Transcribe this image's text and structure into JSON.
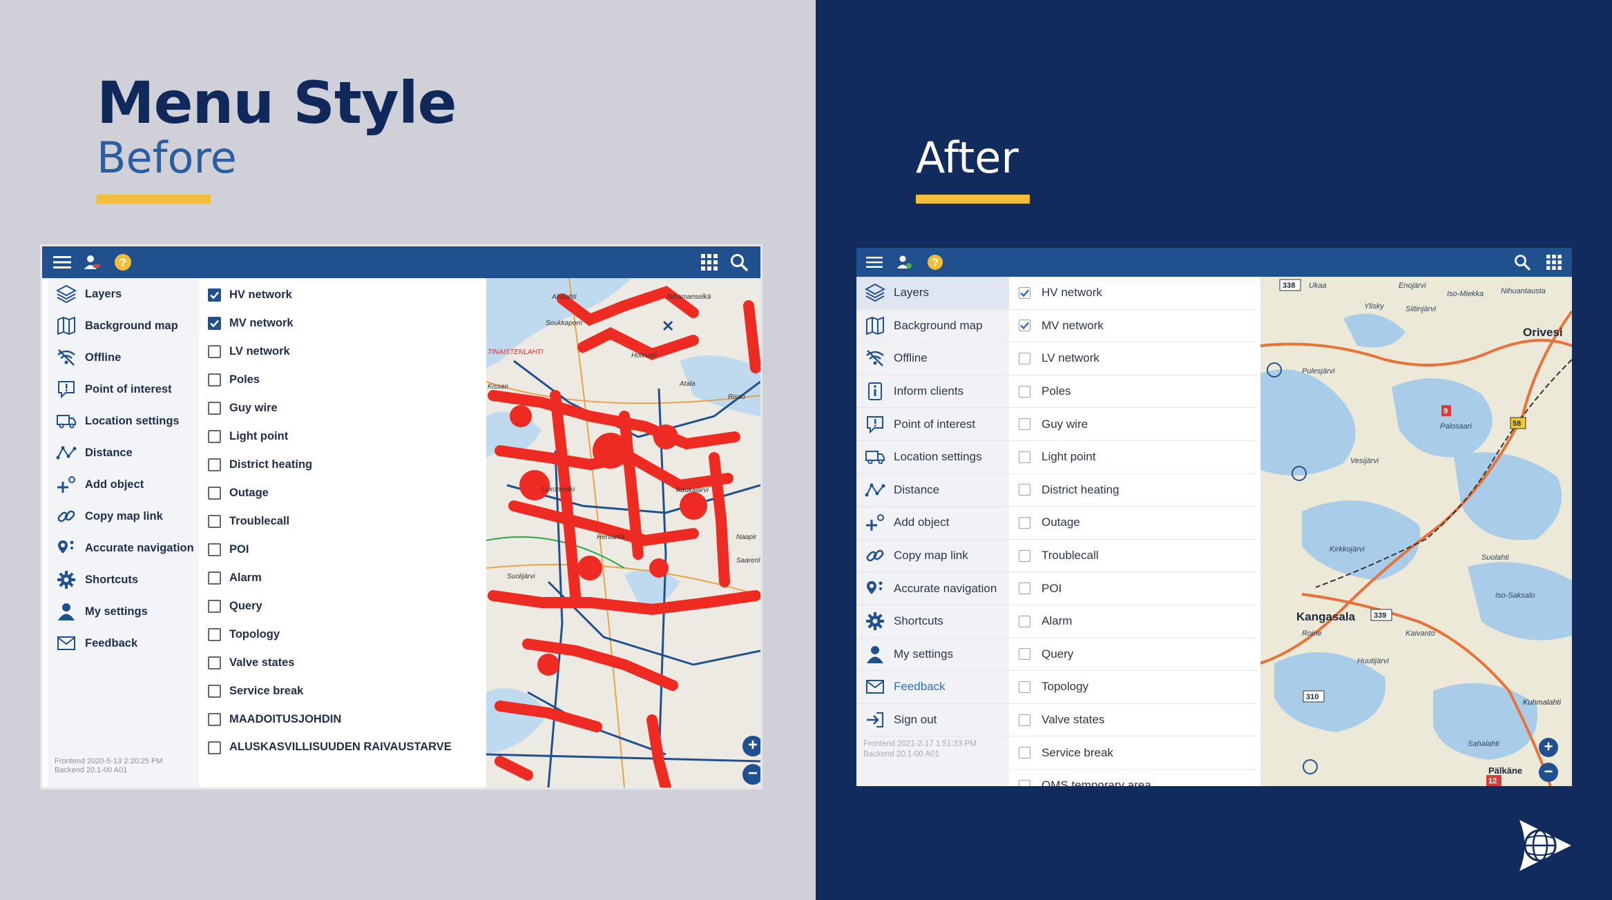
{
  "slide": {
    "title": "Menu Style",
    "before_label": "Before",
    "after_label": "After",
    "colors": {
      "left_bg": "#cfd0d8",
      "right_bg": "#112b5c",
      "title": "#10285a",
      "accent": "#f2bd3a",
      "header": "#21508f"
    }
  },
  "before": {
    "toolbar": {
      "icons": [
        "hamburger-menu-icon",
        "user-location-icon",
        "help-icon",
        "apps-grid-icon",
        "search-icon"
      ]
    },
    "menu": [
      {
        "label": "Layers",
        "icon": "layers-icon"
      },
      {
        "label": "Background map",
        "icon": "map-icon"
      },
      {
        "label": "Offline",
        "icon": "wifi-off-icon"
      },
      {
        "label": "Point of interest",
        "icon": "poi-icon"
      },
      {
        "label": "Location settings",
        "icon": "truck-icon"
      },
      {
        "label": "Distance",
        "icon": "distance-icon"
      },
      {
        "label": "Add object",
        "icon": "add-object-icon"
      },
      {
        "label": "Copy map link",
        "icon": "link-icon"
      },
      {
        "label": "Accurate navigation",
        "icon": "navigation-icon"
      },
      {
        "label": "Shortcuts",
        "icon": "gear-icon"
      },
      {
        "label": "My settings",
        "icon": "user-icon"
      },
      {
        "label": "Feedback",
        "icon": "mail-icon"
      }
    ],
    "version": {
      "frontend": "Frontend 2020-5-13 2:20:25 PM",
      "backend": "Backend 20.1-00 A01"
    },
    "layers": [
      {
        "label": "HV network",
        "checked": true
      },
      {
        "label": "MV network",
        "checked": true
      },
      {
        "label": "LV network",
        "checked": false
      },
      {
        "label": "Poles",
        "checked": false
      },
      {
        "label": "Guy wire",
        "checked": false
      },
      {
        "label": "Light point",
        "checked": false
      },
      {
        "label": "District heating",
        "checked": false
      },
      {
        "label": "Outage",
        "checked": false
      },
      {
        "label": "Troublecall",
        "checked": false
      },
      {
        "label": "POI",
        "checked": false
      },
      {
        "label": "Alarm",
        "checked": false
      },
      {
        "label": "Query",
        "checked": false
      },
      {
        "label": "Topology",
        "checked": false
      },
      {
        "label": "Valve states",
        "checked": false
      },
      {
        "label": "Service break",
        "checked": false
      },
      {
        "label": "MAADOITUSJOHDIN",
        "checked": false
      },
      {
        "label": "ALUSKASVILLISUUDEN RAIVAUSTARVE",
        "checked": false
      }
    ],
    "map_labels": [
      "Aitolahti",
      "Nihamanselkä",
      "Soukkaporri",
      "TINAISTENLAHTI",
      "Holvuori",
      "Kissan",
      "Atala",
      "Risso",
      "Lukonmäki",
      "Kaukajärvi",
      "Hervanta",
      "Suolijärvi",
      "Saarenl",
      "Naapir"
    ]
  },
  "after": {
    "toolbar": {
      "icons": [
        "hamburger-menu-icon",
        "user-location-icon",
        "help-icon",
        "search-icon",
        "apps-grid-icon"
      ]
    },
    "menu": [
      {
        "label": "Layers",
        "icon": "layers-icon"
      },
      {
        "label": "Background map",
        "icon": "map-icon"
      },
      {
        "label": "Offline",
        "icon": "wifi-off-icon"
      },
      {
        "label": "Inform clients",
        "icon": "info-icon"
      },
      {
        "label": "Point of interest",
        "icon": "poi-icon"
      },
      {
        "label": "Location settings",
        "icon": "truck-icon"
      },
      {
        "label": "Distance",
        "icon": "distance-icon"
      },
      {
        "label": "Add object",
        "icon": "add-object-icon"
      },
      {
        "label": "Copy map link",
        "icon": "link-icon"
      },
      {
        "label": "Accurate navigation",
        "icon": "navigation-icon"
      },
      {
        "label": "Shortcuts",
        "icon": "gear-icon"
      },
      {
        "label": "My settings",
        "icon": "user-icon"
      },
      {
        "label": "Feedback",
        "icon": "mail-icon"
      },
      {
        "label": "Sign out",
        "icon": "sign-out-icon"
      }
    ],
    "version": {
      "frontend": "Frontend 2021-2-17 1:51:33 PM",
      "backend": "Backend 20.1-00 A01"
    },
    "layers": [
      {
        "label": "HV network",
        "checked": true
      },
      {
        "label": "MV network",
        "checked": true
      },
      {
        "label": "LV network",
        "checked": false
      },
      {
        "label": "Poles",
        "checked": false
      },
      {
        "label": "Guy wire",
        "checked": false
      },
      {
        "label": "Light point",
        "checked": false
      },
      {
        "label": "District heating",
        "checked": false
      },
      {
        "label": "Outage",
        "checked": false
      },
      {
        "label": "Troublecall",
        "checked": false
      },
      {
        "label": "POI",
        "checked": false
      },
      {
        "label": "Alarm",
        "checked": false
      },
      {
        "label": "Query",
        "checked": false
      },
      {
        "label": "Topology",
        "checked": false
      },
      {
        "label": "Valve states",
        "checked": false
      },
      {
        "label": "Service break",
        "checked": false
      },
      {
        "label": "OMS temporary area",
        "checked": false
      }
    ],
    "map_labels": [
      "Ukaa",
      "Enojärvi",
      "Iso-Miekka",
      "Nihuantausta",
      "Ylisky",
      "Siitinjärvi",
      "Orivesi",
      "Kangasala",
      "Pälkäne",
      "Kuhmalahti",
      "Suolahti",
      "Roine",
      "Kirkkojärvi",
      "Pulesjärvi",
      "Vesijärvi",
      "Huutijärvi",
      "Kaivanto",
      "Sahalahti",
      "Palosaari",
      "Iso-Saksalo"
    ],
    "road_numbers": [
      "338",
      "58",
      "339",
      "310",
      "12",
      "9"
    ]
  }
}
